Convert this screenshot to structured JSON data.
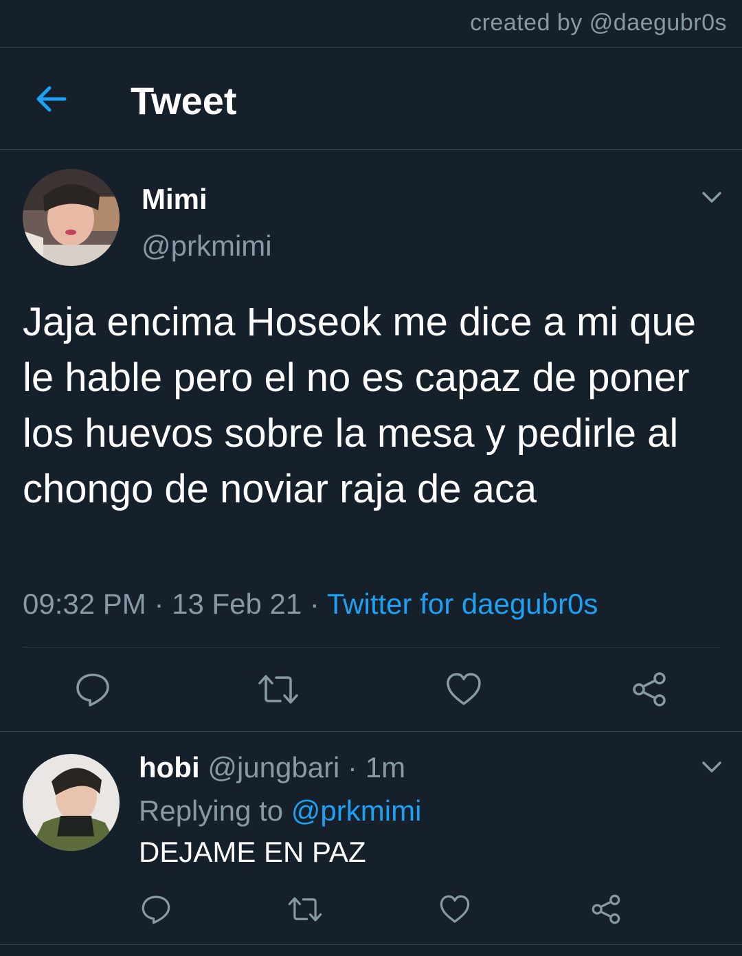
{
  "watermark": "created by @daegubr0s",
  "header": {
    "back_icon": "arrow-left-icon",
    "title": "Tweet"
  },
  "tweet": {
    "name": "Mimi",
    "handle": "@prkmimi",
    "text": "Jaja encima Hoseok me dice a mi que le hable pero el no es capaz de poner los huevos sobre la mesa y pedirle al chongo de noviar raja de aca",
    "time": "09:32 PM",
    "separator": " · ",
    "date": "13 Feb 21",
    "app": "Twitter for daegubr0s",
    "actions": [
      "reply-icon",
      "retweet-icon",
      "like-icon",
      "share-icon"
    ]
  },
  "reply": {
    "name": "hobi",
    "handle": "@jungbari",
    "time_sep": " · ",
    "time": "1m",
    "replying_label": "Replying to ",
    "replying_to": "@prkmimi",
    "text": "DEJAME EN PAZ",
    "actions": [
      "reply-icon",
      "retweet-icon",
      "like-icon",
      "share-icon"
    ]
  },
  "colors": {
    "background": "#15202b",
    "accent": "#1da1f2",
    "secondary_text": "#8899a6",
    "divider": "#38444d"
  }
}
